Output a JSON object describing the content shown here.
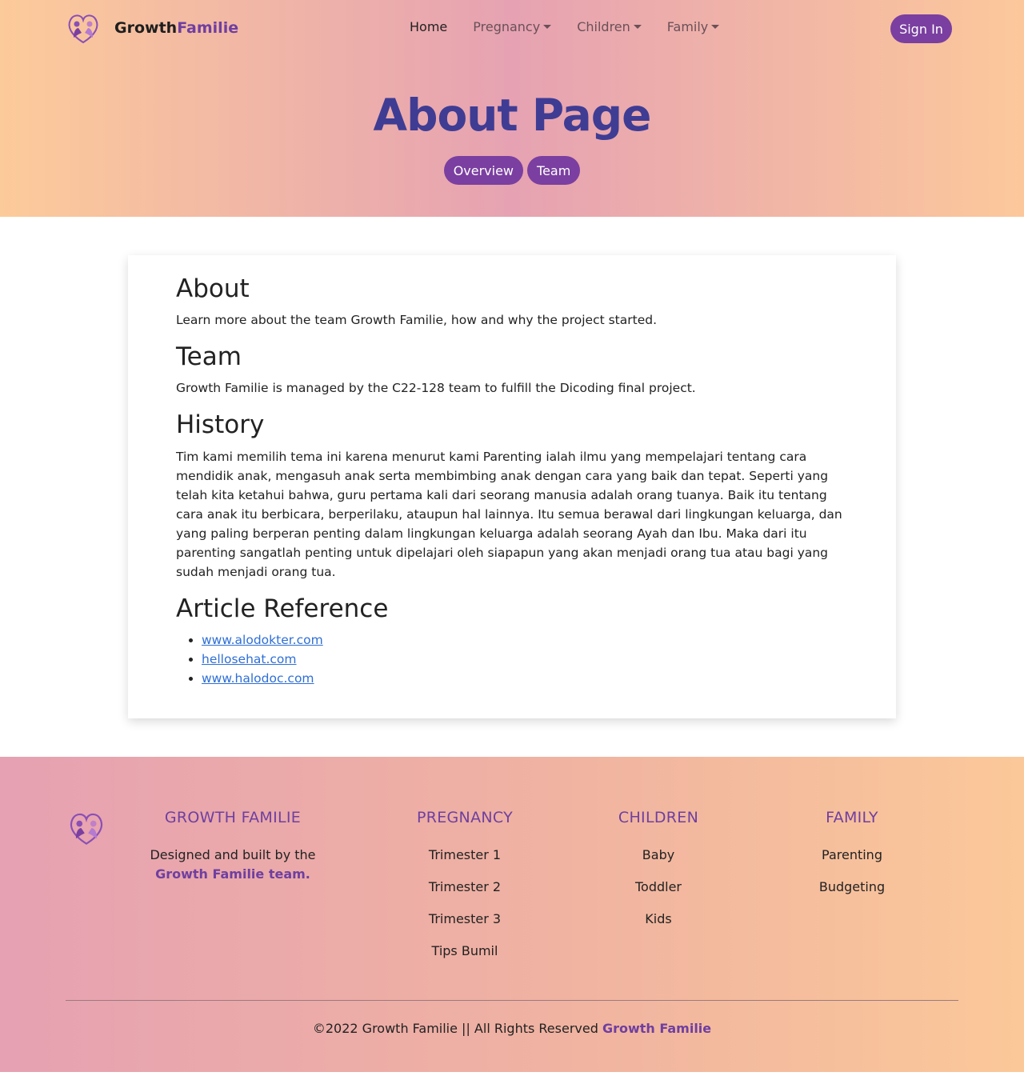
{
  "brand": {
    "name_part1": "Growth",
    "name_part2": "Familie",
    "logo_icon": "family-heart-icon"
  },
  "nav": {
    "home": "Home",
    "pregnancy": "Pregnancy",
    "children": "Children",
    "family": "Family",
    "signin": "Sign In"
  },
  "hero": {
    "title": "About Page",
    "tabs": [
      "Overview",
      "Team"
    ]
  },
  "content": {
    "about_heading": "About",
    "about_text": "Learn more about the team Growth Familie, how and why the project started.",
    "team_heading": "Team",
    "team_text": "Growth Familie is managed by the C22-128 team to fulfill the Dicoding final project.",
    "history_heading": "History",
    "history_text": "Tim kami memilih tema ini karena menurut kami Parenting ialah ilmu yang mempelajari tentang cara mendidik anak, mengasuh anak serta membimbing anak dengan cara yang baik dan tepat. Seperti yang telah kita ketahui bahwa, guru pertama kali dari seorang manusia adalah orang tuanya. Baik itu tentang cara anak itu berbicara, berperilaku, ataupun hal lainnya. Itu semua berawal dari lingkungan keluarga, dan yang paling berperan penting dalam lingkungan keluarga adalah seorang Ayah dan Ibu. Maka dari itu parenting sangatlah penting untuk dipelajari oleh siapapun yang akan menjadi orang tua atau bagi yang sudah menjadi orang tua.",
    "reference_heading": "Article Reference",
    "references": [
      "www.alodokter.com",
      "hellosehat.com",
      "www.halodoc.com"
    ]
  },
  "footer": {
    "growth": {
      "heading": "GROWTH FAMILIE",
      "desc": "Designed and built by the",
      "desc_bold": "Growth Familie team."
    },
    "pregnancy": {
      "heading": "PREGNANCY",
      "links": [
        "Trimester 1",
        "Trimester 2",
        "Trimester 3",
        "Tips Bumil"
      ]
    },
    "children": {
      "heading": "CHILDREN",
      "links": [
        "Baby",
        "Toddler",
        "Kids"
      ]
    },
    "family": {
      "heading": "FAMILY",
      "links": [
        "Parenting",
        "Budgeting"
      ]
    },
    "copyright": "©2022 Growth Familie || All Rights Reserved",
    "copyright_bold": "Growth Familie"
  },
  "colors": {
    "accent": "#7a3fa0",
    "title": "#3f3c94",
    "link": "#2f6fd6"
  }
}
